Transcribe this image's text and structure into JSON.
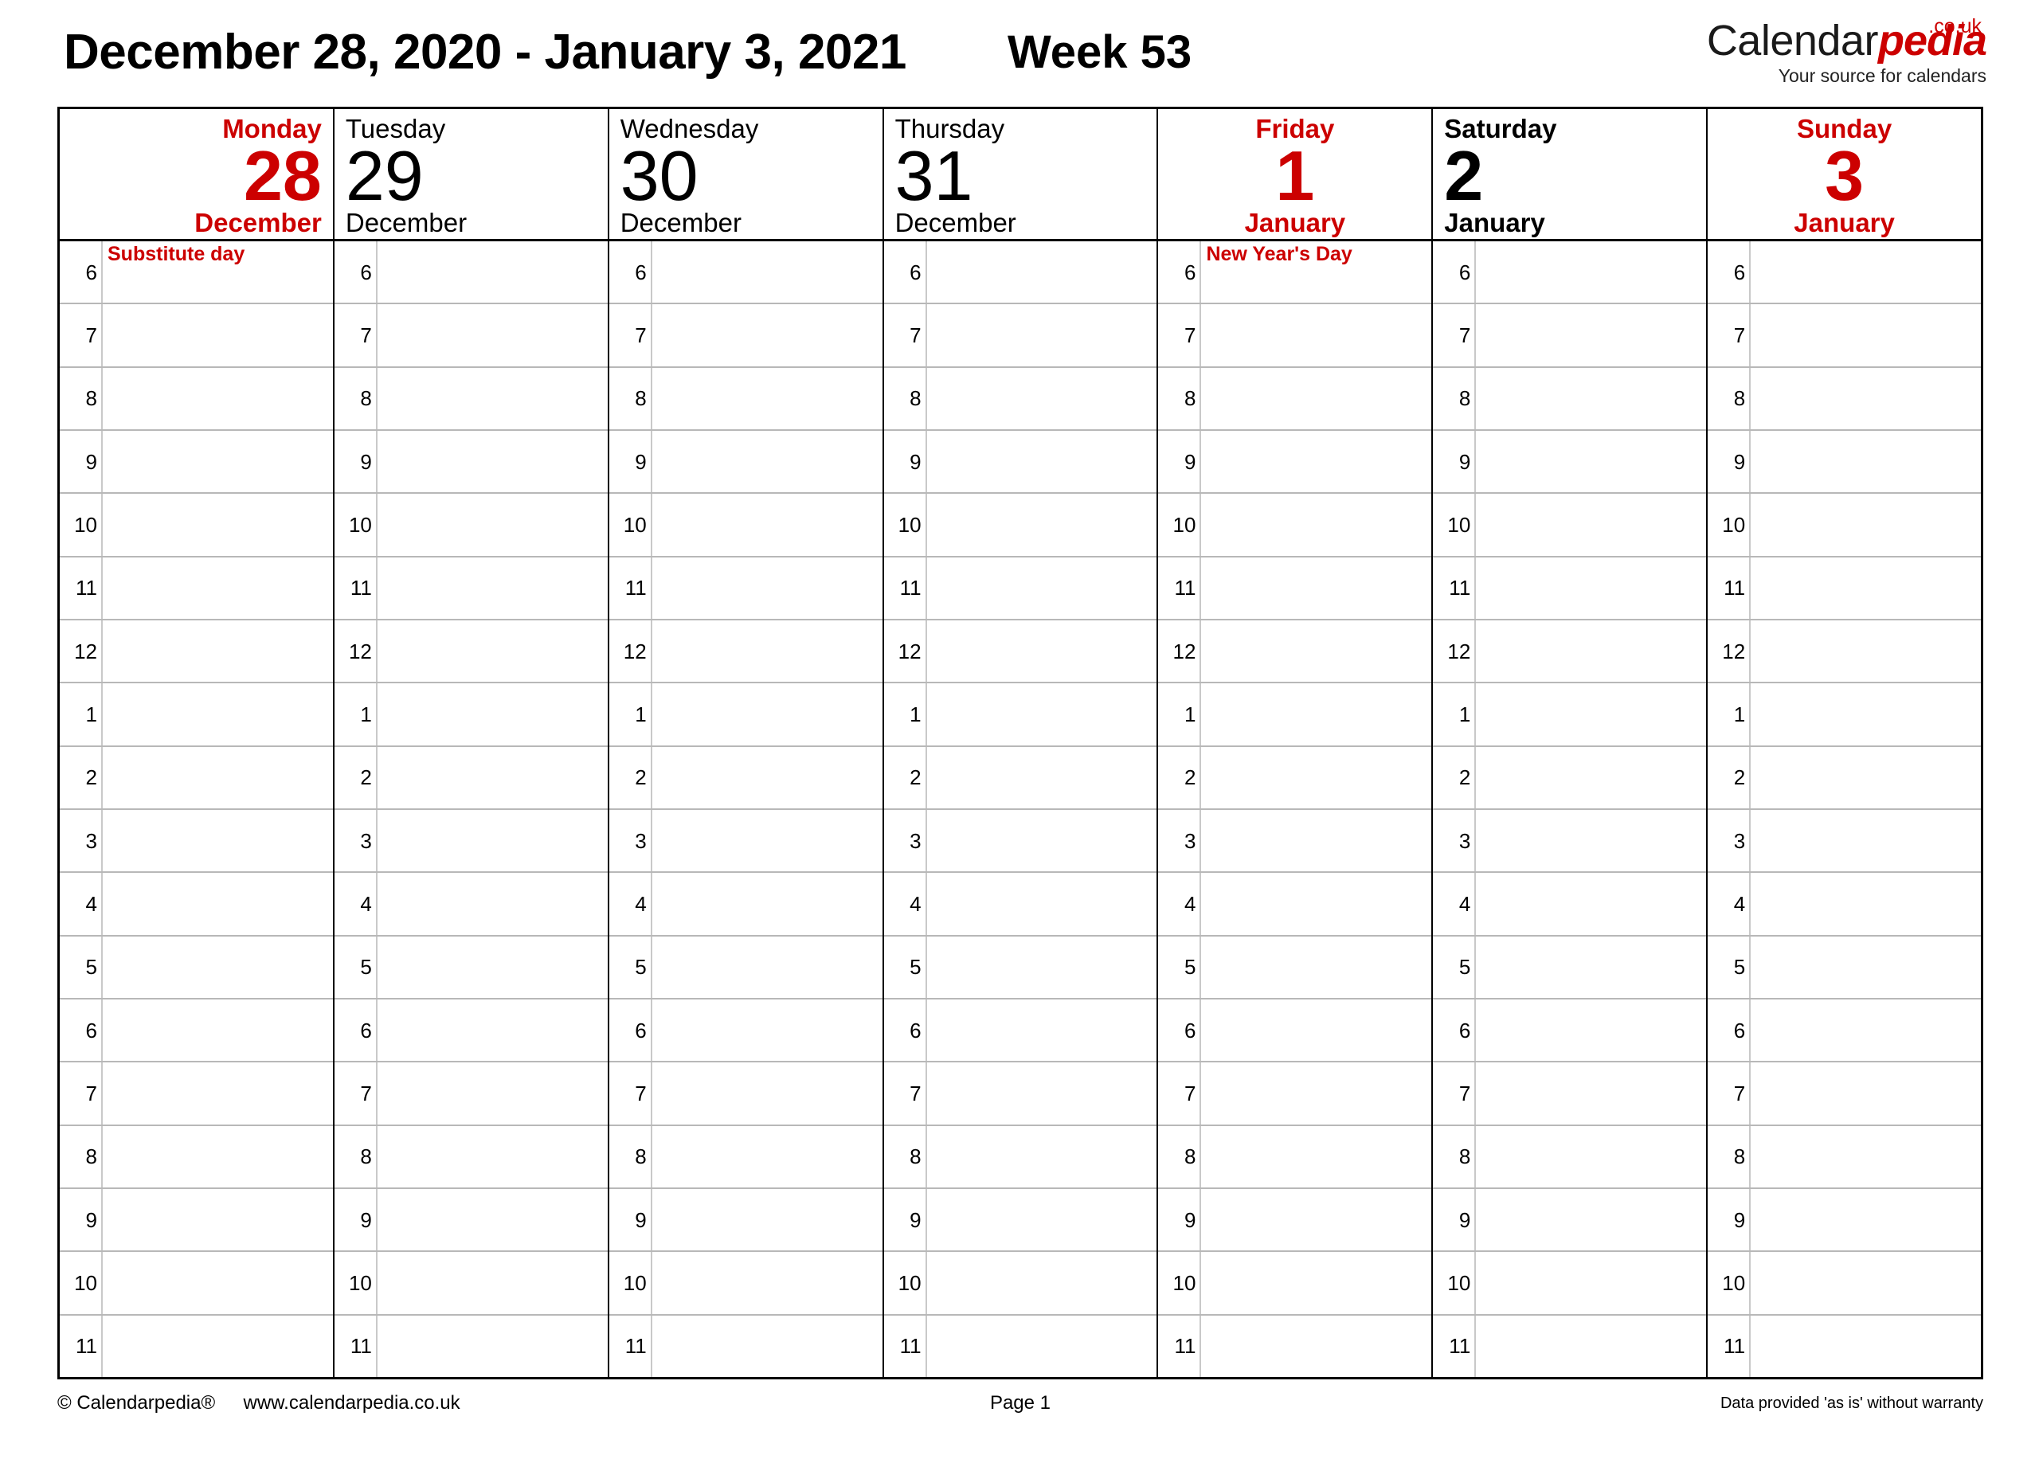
{
  "header": {
    "date_range": "December 28, 2020 - January 3, 2021",
    "week_label": "Week 53",
    "brand": {
      "name_part1": "Calendar",
      "name_part2": "pedia",
      "tld": ".co.uk",
      "tagline": "Your source for calendars"
    }
  },
  "colors": {
    "accent_red": "#cc0000",
    "text_black": "#000000",
    "grid_line": "#b8b8b8",
    "grid_border": "#000000"
  },
  "hours": [
    "6",
    "7",
    "8",
    "9",
    "10",
    "11",
    "12",
    "1",
    "2",
    "3",
    "4",
    "5",
    "6",
    "7",
    "8",
    "9",
    "10",
    "11"
  ],
  "days": [
    {
      "weekday": "Monday",
      "daynum": "28",
      "month": "December",
      "style": "accent",
      "align": "al-right",
      "events": {
        "0": "Substitute day"
      }
    },
    {
      "weekday": "Tuesday",
      "daynum": "29",
      "month": "December",
      "style": "plain",
      "align": "al-left",
      "events": {}
    },
    {
      "weekday": "Wednesday",
      "daynum": "30",
      "month": "December",
      "style": "plain",
      "align": "al-left",
      "events": {}
    },
    {
      "weekday": "Thursday",
      "daynum": "31",
      "month": "December",
      "style": "plain",
      "align": "al-left",
      "events": {}
    },
    {
      "weekday": "Friday",
      "daynum": "1",
      "month": "January",
      "style": "accent",
      "align": "al-center",
      "events": {
        "0": "New Year's Day"
      }
    },
    {
      "weekday": "Saturday",
      "daynum": "2",
      "month": "January",
      "style": "strong",
      "align": "al-left",
      "events": {}
    },
    {
      "weekday": "Sunday",
      "daynum": "3",
      "month": "January",
      "style": "accent",
      "align": "al-center",
      "events": {}
    }
  ],
  "footer": {
    "copyright": "© Calendarpedia®",
    "website": "www.calendarpedia.co.uk",
    "page": "Page 1",
    "disclaimer": "Data provided 'as is' without warranty"
  }
}
